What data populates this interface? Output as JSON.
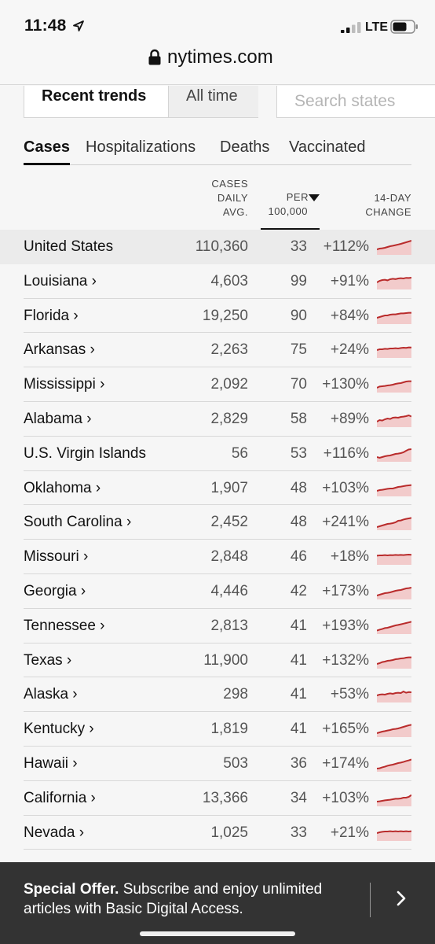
{
  "status": {
    "time": "11:48",
    "network": "LTE",
    "icons": [
      "location-arrow-icon",
      "signal-icon",
      "battery-icon"
    ]
  },
  "browser": {
    "url": "nytimes.com",
    "icon": "lock-icon"
  },
  "controls": {
    "recent_label": "Recent trends",
    "alltime_label": "All time",
    "search_placeholder": "Search states"
  },
  "tabs": [
    {
      "label": "Cases",
      "active": true
    },
    {
      "label": "Hospitalizations",
      "active": false
    },
    {
      "label": "Deaths",
      "active": false
    },
    {
      "label": "Vaccinated",
      "active": false
    }
  ],
  "table": {
    "headers": {
      "avg": [
        "CASES",
        "DAILY",
        "AVG."
      ],
      "per": [
        "PER",
        "100,000"
      ],
      "change": [
        "14-DAY",
        "CHANGE"
      ]
    },
    "sort_icon": "sort-down-triangle-icon",
    "colors": {
      "spark_line": "#b92c2c",
      "spark_fill": "#f2cbcb",
      "highlight_row": "#ebebeb"
    },
    "rows": [
      {
        "name": "United States",
        "avg": "110,360",
        "per": "33",
        "change": "+112%",
        "trend": [
          0.35,
          0.4,
          0.42,
          0.45,
          0.5,
          0.55,
          0.58,
          0.62,
          0.66,
          0.7,
          0.75,
          0.8,
          0.85,
          0.9
        ]
      },
      {
        "name": "Louisiana ›",
        "avg": "4,603",
        "per": "99",
        "change": "+91%",
        "trend": [
          0.45,
          0.55,
          0.6,
          0.62,
          0.58,
          0.65,
          0.68,
          0.66,
          0.7,
          0.72,
          0.7,
          0.74,
          0.73,
          0.75
        ]
      },
      {
        "name": "Florida ›",
        "avg": "19,250",
        "per": "90",
        "change": "+84%",
        "trend": [
          0.4,
          0.45,
          0.5,
          0.55,
          0.55,
          0.6,
          0.62,
          0.62,
          0.65,
          0.68,
          0.68,
          0.7,
          0.72,
          0.72
        ]
      },
      {
        "name": "Arkansas ›",
        "avg": "2,263",
        "per": "75",
        "change": "+24%",
        "trend": [
          0.5,
          0.55,
          0.55,
          0.58,
          0.57,
          0.6,
          0.6,
          0.62,
          0.6,
          0.63,
          0.65,
          0.64,
          0.67,
          0.66
        ]
      },
      {
        "name": "Mississippi ›",
        "avg": "2,092",
        "per": "70",
        "change": "+130%",
        "trend": [
          0.3,
          0.38,
          0.4,
          0.42,
          0.45,
          0.47,
          0.5,
          0.55,
          0.58,
          0.6,
          0.65,
          0.7,
          0.72,
          0.72
        ]
      },
      {
        "name": "Alabama ›",
        "avg": "2,829",
        "per": "58",
        "change": "+89%",
        "trend": [
          0.35,
          0.45,
          0.42,
          0.5,
          0.55,
          0.52,
          0.6,
          0.62,
          0.6,
          0.65,
          0.67,
          0.7,
          0.75,
          0.68
        ]
      },
      {
        "name": "U.S. Virgin Islands",
        "avg": "56",
        "per": "53",
        "change": "+116%",
        "trend": [
          0.3,
          0.25,
          0.3,
          0.35,
          0.38,
          0.4,
          0.45,
          0.5,
          0.52,
          0.55,
          0.6,
          0.7,
          0.78,
          0.8
        ]
      },
      {
        "name": "Oklahoma ›",
        "avg": "1,907",
        "per": "48",
        "change": "+103%",
        "trend": [
          0.35,
          0.4,
          0.42,
          0.45,
          0.48,
          0.5,
          0.5,
          0.55,
          0.6,
          0.62,
          0.65,
          0.68,
          0.7,
          0.72
        ]
      },
      {
        "name": "South Carolina ›",
        "avg": "2,452",
        "per": "48",
        "change": "+241%",
        "trend": [
          0.2,
          0.25,
          0.3,
          0.35,
          0.4,
          0.42,
          0.45,
          0.5,
          0.6,
          0.62,
          0.68,
          0.72,
          0.75,
          0.78
        ]
      },
      {
        "name": "Missouri ›",
        "avg": "2,848",
        "per": "46",
        "change": "+18%",
        "trend": [
          0.58,
          0.6,
          0.6,
          0.62,
          0.6,
          0.62,
          0.61,
          0.63,
          0.62,
          0.63,
          0.62,
          0.64,
          0.65,
          0.64
        ]
      },
      {
        "name": "Georgia ›",
        "avg": "4,446",
        "per": "42",
        "change": "+173%",
        "trend": [
          0.25,
          0.3,
          0.35,
          0.4,
          0.42,
          0.45,
          0.5,
          0.55,
          0.58,
          0.6,
          0.65,
          0.7,
          0.72,
          0.75
        ]
      },
      {
        "name": "Tennessee ›",
        "avg": "2,813",
        "per": "41",
        "change": "+193%",
        "trend": [
          0.22,
          0.28,
          0.32,
          0.38,
          0.4,
          0.45,
          0.5,
          0.55,
          0.58,
          0.62,
          0.66,
          0.7,
          0.74,
          0.78
        ]
      },
      {
        "name": "Texas ›",
        "avg": "11,900",
        "per": "41",
        "change": "+132%",
        "trend": [
          0.3,
          0.35,
          0.42,
          0.45,
          0.5,
          0.52,
          0.55,
          0.6,
          0.62,
          0.65,
          0.66,
          0.7,
          0.72,
          0.72
        ]
      },
      {
        "name": "Alaska ›",
        "avg": "298",
        "per": "41",
        "change": "+53%",
        "trend": [
          0.45,
          0.5,
          0.52,
          0.5,
          0.55,
          0.58,
          0.55,
          0.6,
          0.62,
          0.6,
          0.7,
          0.62,
          0.66,
          0.65
        ]
      },
      {
        "name": "Kentucky ›",
        "avg": "1,819",
        "per": "41",
        "change": "+165%",
        "trend": [
          0.25,
          0.3,
          0.35,
          0.38,
          0.42,
          0.45,
          0.5,
          0.52,
          0.55,
          0.6,
          0.65,
          0.7,
          0.75,
          0.78
        ]
      },
      {
        "name": "Hawaii ›",
        "avg": "503",
        "per": "36",
        "change": "+174%",
        "trend": [
          0.2,
          0.22,
          0.28,
          0.32,
          0.38,
          0.42,
          0.45,
          0.5,
          0.55,
          0.58,
          0.62,
          0.68,
          0.72,
          0.78
        ]
      },
      {
        "name": "California ›",
        "avg": "13,366",
        "per": "34",
        "change": "+103%",
        "trend": [
          0.3,
          0.32,
          0.35,
          0.38,
          0.4,
          0.42,
          0.45,
          0.48,
          0.48,
          0.5,
          0.55,
          0.55,
          0.6,
          0.72
        ]
      },
      {
        "name": "Nevada ›",
        "avg": "1,025",
        "per": "33",
        "change": "+21%",
        "trend": [
          0.5,
          0.55,
          0.58,
          0.6,
          0.6,
          0.62,
          0.6,
          0.62,
          0.6,
          0.62,
          0.6,
          0.62,
          0.6,
          0.62
        ]
      }
    ]
  },
  "offer": {
    "bold": "Special Offer.",
    "text": " Subscribe and enjoy unlimited articles with Basic Digital Access.",
    "arrow_icon": "chevron-right-icon"
  }
}
